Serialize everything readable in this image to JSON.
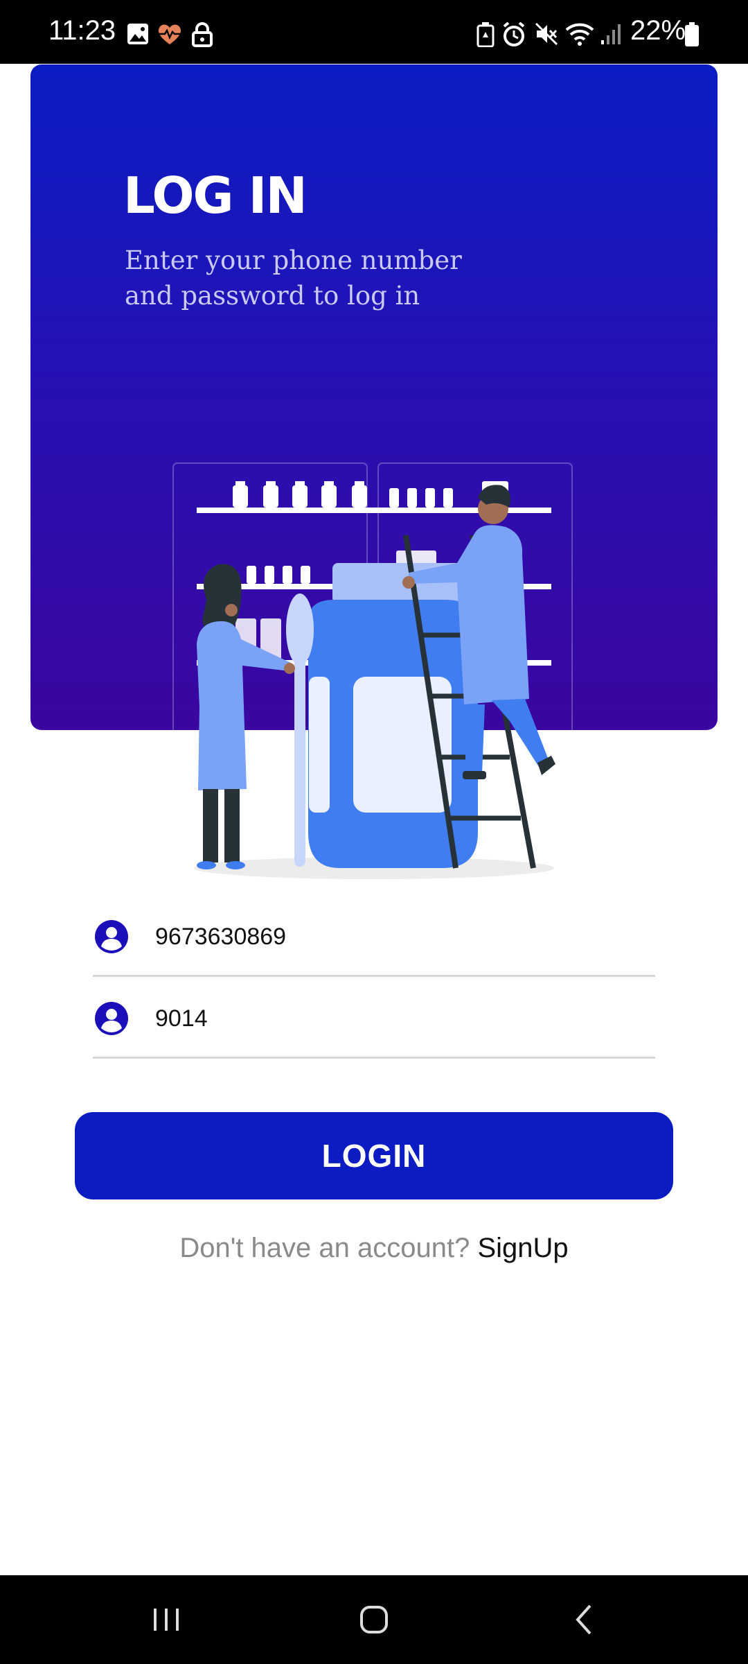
{
  "status_bar": {
    "time": "11:23",
    "battery_percent": "22%",
    "icons_left": [
      "image-icon",
      "heart-rate-icon",
      "lock-icon"
    ],
    "icons_right": [
      "battery-saver-icon",
      "alarm-icon",
      "mute-icon",
      "wifi-icon",
      "signal-icon",
      "battery-icon"
    ]
  },
  "hero": {
    "title": "LOG IN",
    "subtitle": "Enter your phone number and password to log in"
  },
  "form": {
    "phone_value": "9673630869",
    "password_value": "9014",
    "login_label": "LOGIN"
  },
  "footer": {
    "prompt": "Don't have an account?",
    "signup_label": "SignUp"
  },
  "colors": {
    "primary": "#0a1cc2",
    "hero_top": "#0a1dc4",
    "hero_bottom": "#3a06a0",
    "accent_light": "#3f7df0"
  },
  "nav_bar": {
    "buttons": [
      "recent-apps-icon",
      "home-icon",
      "back-icon"
    ]
  }
}
